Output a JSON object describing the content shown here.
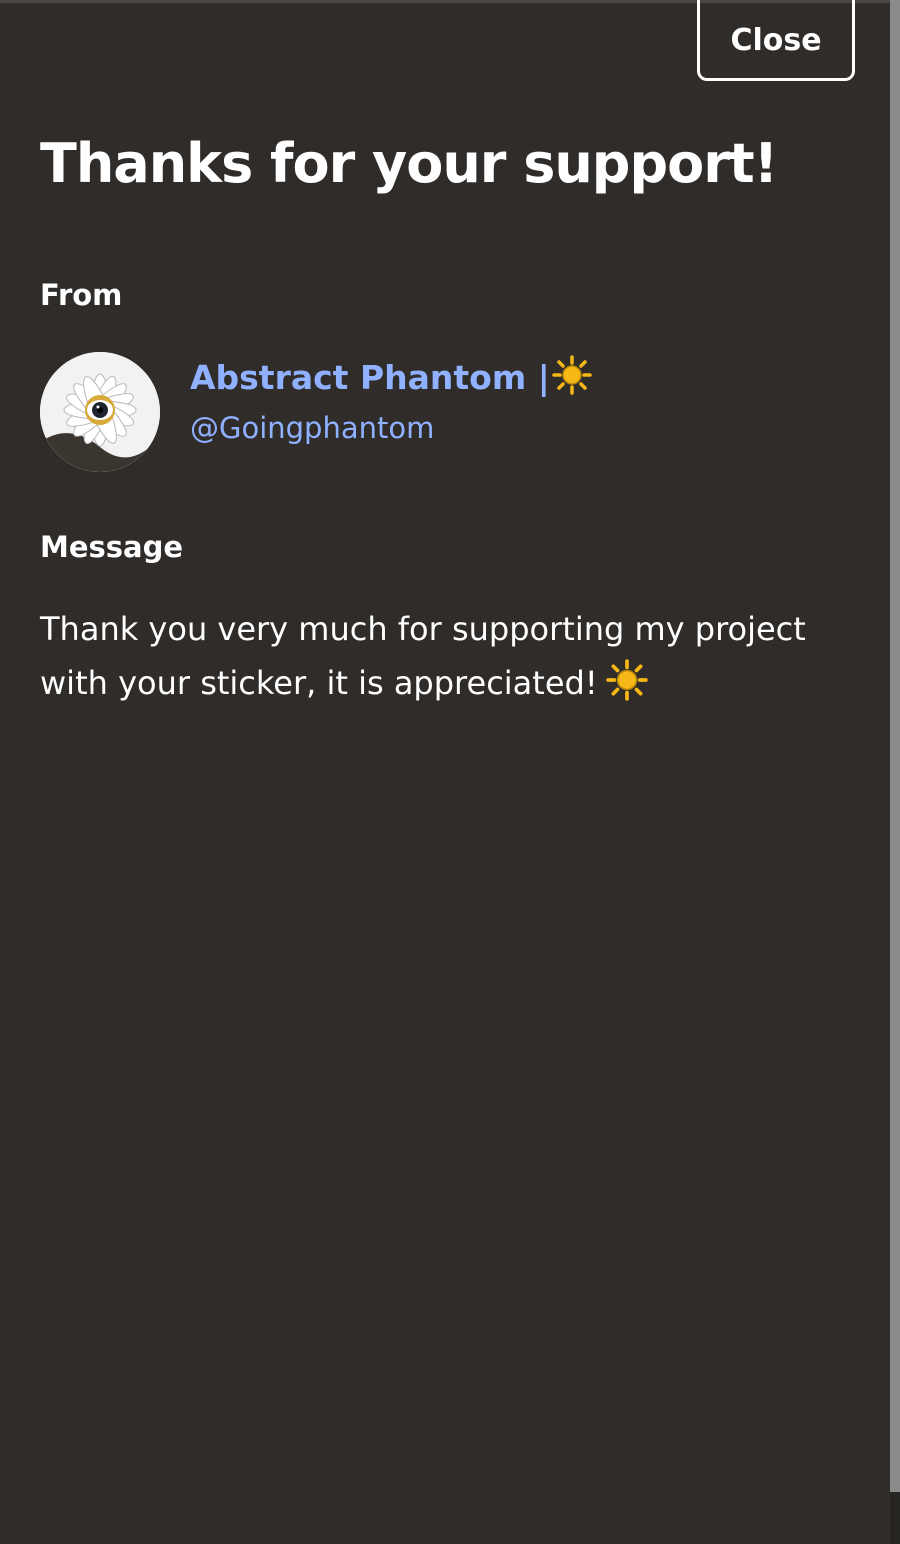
{
  "header": {
    "close_label": "Close"
  },
  "title": "Thanks for your support!",
  "from": {
    "label": "From",
    "sender_name": "Abstract Phantom |",
    "sender_emoji": "sun-icon",
    "handle": "@Goingphantom"
  },
  "message": {
    "label": "Message",
    "line1": "Thank you very much for supporting my project",
    "line2": "with your sticker, it is appreciated!",
    "trailing_emoji": "sun-icon"
  },
  "colors": {
    "background": "#2f2c29",
    "text": "#ffffff",
    "link": "#8fb1ff",
    "sun": "#f5b816"
  }
}
